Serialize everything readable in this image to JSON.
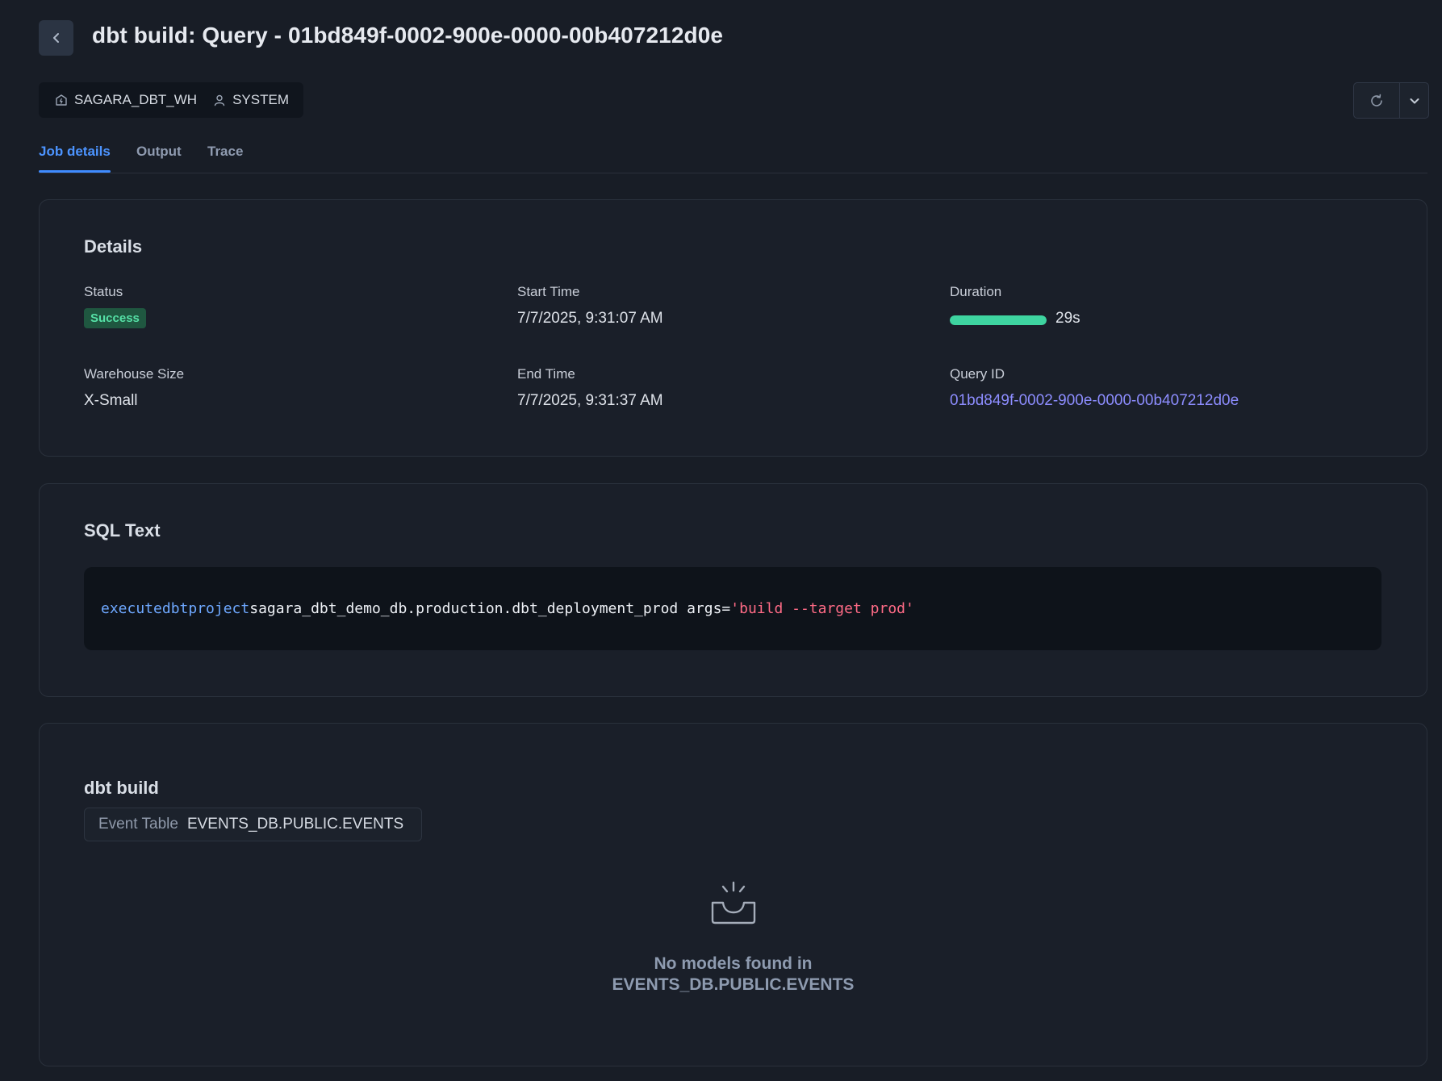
{
  "header": {
    "back_icon": "chevron-left-icon",
    "title": "dbt build: Query - 01bd849f-0002-900e-0000-00b407212d0e"
  },
  "meta": {
    "warehouse": {
      "icon": "warehouse-icon",
      "label": "SAGARA_DBT_WH"
    },
    "user": {
      "icon": "user-icon",
      "label": "SYSTEM"
    }
  },
  "actions": {
    "refresh_icon": "refresh-icon",
    "more_icon": "chevron-down-icon"
  },
  "tabs": [
    {
      "label": "Job details",
      "active": true
    },
    {
      "label": "Output",
      "active": false
    },
    {
      "label": "Trace",
      "active": false
    }
  ],
  "details": {
    "title": "Details",
    "status_label": "Status",
    "status_value": "Success",
    "start_label": "Start Time",
    "start_value": "7/7/2025, 9:31:07 AM",
    "duration_label": "Duration",
    "duration_value": "29s",
    "duration_fill_fraction": 1.0,
    "warehouse_size_label": "Warehouse Size",
    "warehouse_size_value": "X-Small",
    "end_label": "End Time",
    "end_value": "7/7/2025, 9:31:37 AM",
    "query_id_label": "Query ID",
    "query_id_value": "01bd849f-0002-900e-0000-00b407212d0e"
  },
  "sql": {
    "title": "SQL Text",
    "tokens": {
      "t1": "execute",
      "t2": "dbt",
      "t3": "project",
      "t4": "sagara_dbt_demo_db.production.dbt_deployment_prod args=",
      "t5": "'build --target prod'"
    }
  },
  "dbt_build": {
    "title": "dbt build",
    "event_table_label": "Event Table",
    "event_table_value": "EVENTS_DB.PUBLIC.EVENTS",
    "empty_icon": "empty-inbox-icon",
    "empty_line1": "No models found in",
    "empty_line2": "EVENTS_DB.PUBLIC.EVENTS"
  },
  "colors": {
    "background": "#181d26",
    "accent": "#4c94ff",
    "success": "#3ed4a0",
    "link": "#8d8dff",
    "sql_keyword": "#6ea8ff",
    "sql_string": "#ff6b86"
  }
}
